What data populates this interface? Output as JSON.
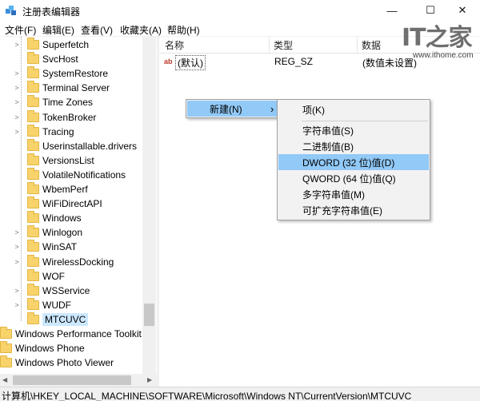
{
  "window": {
    "title": "注册表编辑器",
    "minimize_glyph": "—",
    "maximize_glyph": "☐",
    "close_glyph": "✕"
  },
  "menubar": {
    "items": [
      "文件(F)",
      "编辑(E)",
      "查看(V)",
      "收藏夹(A)",
      "帮助(H)"
    ]
  },
  "tree": {
    "items": [
      {
        "label": "Superfetch",
        "expandable": true
      },
      {
        "label": "SvcHost",
        "expandable": false
      },
      {
        "label": "SystemRestore",
        "expandable": true
      },
      {
        "label": "Terminal Server",
        "expandable": true
      },
      {
        "label": "Time Zones",
        "expandable": true
      },
      {
        "label": "TokenBroker",
        "expandable": true
      },
      {
        "label": "Tracing",
        "expandable": true
      },
      {
        "label": "Userinstallable.drivers",
        "expandable": false
      },
      {
        "label": "VersionsList",
        "expandable": false
      },
      {
        "label": "VolatileNotifications",
        "expandable": false
      },
      {
        "label": "WbemPerf",
        "expandable": false
      },
      {
        "label": "WiFiDirectAPI",
        "expandable": false
      },
      {
        "label": "Windows",
        "expandable": false
      },
      {
        "label": "Winlogon",
        "expandable": true
      },
      {
        "label": "WinSAT",
        "expandable": true
      },
      {
        "label": "WirelessDocking",
        "expandable": true
      },
      {
        "label": "WOF",
        "expandable": false
      },
      {
        "label": "WSService",
        "expandable": true
      },
      {
        "label": "WUDF",
        "expandable": true
      },
      {
        "label": "MTCUVC",
        "expandable": false,
        "selected": true
      }
    ],
    "root_items": [
      "Windows Performance Toolkit",
      "Windows Phone",
      "Windows Photo Viewer"
    ]
  },
  "list": {
    "columns": [
      "名称",
      "类型",
      "数据"
    ],
    "rows": [
      {
        "icon": "ab",
        "name": "(默认)",
        "type": "REG_SZ",
        "data": "(数值未设置)"
      }
    ]
  },
  "context_menu": {
    "new_label": "新建(N)",
    "arrow": "›"
  },
  "submenu": {
    "items": [
      {
        "label": "项(K)"
      },
      {
        "label": "字符串值(S)"
      },
      {
        "label": "二进制值(B)"
      },
      {
        "label": "DWORD (32 位)值(D)",
        "highlighted": true
      },
      {
        "label": "QWORD (64 位)值(Q)"
      },
      {
        "label": "多字符串值(M)"
      },
      {
        "label": "可扩充字符串值(E)"
      }
    ]
  },
  "status": {
    "path": "计算机\\HKEY_LOCAL_MACHINE\\SOFTWARE\\Microsoft\\Windows NT\\CurrentVersion\\MTCUVC"
  },
  "watermark": {
    "logo": "IT之家",
    "url": "www.ithome.com"
  },
  "colors": {
    "selection": "#cce8ff",
    "menu_hover": "#91c9f7",
    "folder": "#f8d36b"
  }
}
